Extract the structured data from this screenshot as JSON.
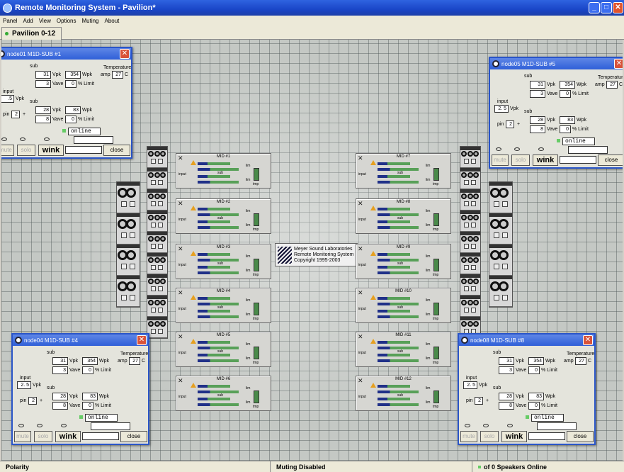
{
  "window": {
    "title": "Remote Monitoring System - Pavilion*"
  },
  "menu": [
    "Panel",
    "Add",
    "View",
    "Options",
    "Muting",
    "About"
  ],
  "tab": {
    "label": "Pavilion 0-12"
  },
  "status": {
    "left": "Polarity",
    "middle": "Muting Disabled",
    "right": "of 0  Speakers Online"
  },
  "logo": {
    "line1": "Meyer Sound Laboratories",
    "line2": "Remote Monitoring System",
    "line3": "Copyright 1995-2003"
  },
  "modules_left": [
    "MID #1",
    "MID #2",
    "MID #3",
    "MID #4",
    "MID #5",
    "MID #6"
  ],
  "modules_right": [
    "MID #7",
    "MID #8",
    "MID #9",
    "MID #10",
    "MID #11",
    "MID #12"
  ],
  "module_labels": {
    "input": "input",
    "sub": "sub",
    "lim": "lim",
    "tmp": "tmp"
  },
  "nodes": [
    {
      "title": "node01  M1D-SUB #1",
      "sub1_vpk": "31",
      "sub1_wpk": "354",
      "sub1_vave": "3",
      "sub1_limit": "0",
      "sub2_vpk": "28",
      "sub2_wpk": "83",
      "sub2_vave": "8",
      "sub2_limit": "0",
      "amp_temp": "27",
      "input": ".5",
      "pin": "2"
    },
    {
      "title": "node05  M1D-SUB #5",
      "sub1_vpk": "31",
      "sub1_wpk": "354",
      "sub1_vave": "3",
      "sub1_limit": "0",
      "sub2_vpk": "28",
      "sub2_wpk": "83",
      "sub2_vave": "8",
      "sub2_limit": "0",
      "amp_temp": "27",
      "input": "2. 5",
      "pin": "2"
    },
    {
      "title": "node04  M1D-SUB #4",
      "sub1_vpk": "31",
      "sub1_wpk": "354",
      "sub1_vave": "3",
      "sub1_limit": "0",
      "sub2_vpk": "28",
      "sub2_wpk": "83",
      "sub2_vave": "8",
      "sub2_limit": "0",
      "amp_temp": "27",
      "input": "2. 5",
      "pin": "2"
    },
    {
      "title": "node08  M1D-SUB #8",
      "sub1_vpk": "31",
      "sub1_wpk": "354",
      "sub1_vave": "3",
      "sub1_limit": "0",
      "sub2_vpk": "28",
      "sub2_wpk": "83",
      "sub2_vave": "8",
      "sub2_limit": "0",
      "amp_temp": "27",
      "input": "2. 5",
      "pin": "2"
    }
  ],
  "node_labels": {
    "sub": "sub",
    "temperature": "Temperature",
    "amp": "amp",
    "c": "C",
    "vpk": "Vpk",
    "wpk": "Wpk",
    "vave": "Vave",
    "limit": "% Limit",
    "input": "input",
    "pin": "pin",
    "plus": "+",
    "online": "online",
    "mute": "mute",
    "solo": "solo",
    "wink": "wink",
    "close": "close"
  }
}
